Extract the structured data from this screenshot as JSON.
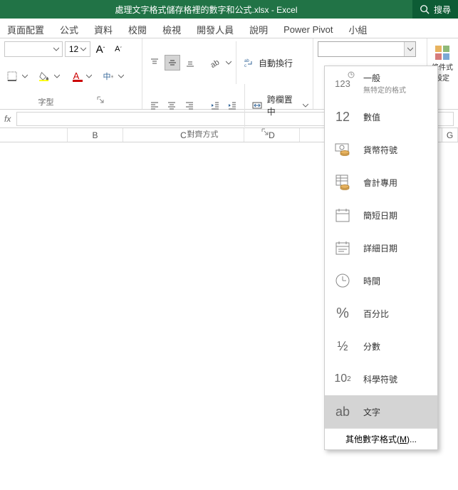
{
  "titlebar": {
    "title": "處理文字格式儲存格裡的數字和公式.xlsx - Excel",
    "search": "搜尋"
  },
  "tabs": [
    "頁面配置",
    "公式",
    "資料",
    "校閱",
    "檢視",
    "開發人員",
    "說明",
    "Power Pivot",
    "小組"
  ],
  "ribbon": {
    "font_size": "12",
    "a_large": "A",
    "a_small": "A",
    "cn_label": "中",
    "wrap_text": "自動換行",
    "merge_center": "跨欄置中",
    "group_font": "字型",
    "group_align": "對齊方式",
    "cond_fmt": "條件式",
    "cond_fmt_sub": "設定"
  },
  "numfmt": {
    "items": [
      {
        "icon": "123-clock",
        "label": "一般",
        "sub": "無特定的格式"
      },
      {
        "icon": "12",
        "label": "數值"
      },
      {
        "icon": "currency",
        "label": "貨幣符號"
      },
      {
        "icon": "accounting",
        "label": "會計專用"
      },
      {
        "icon": "date-short",
        "label": "簡短日期"
      },
      {
        "icon": "date-long",
        "label": "詳細日期"
      },
      {
        "icon": "clock",
        "label": "時間"
      },
      {
        "icon": "percent",
        "label": "百分比"
      },
      {
        "icon": "fraction",
        "label": "分數"
      },
      {
        "icon": "sci",
        "label": "科學符號"
      },
      {
        "icon": "ab",
        "label": "文字"
      }
    ],
    "more": "其他數字格式(",
    "more_u": "M",
    "more_end": ")..."
  },
  "formula_bar": {
    "fx": "fx"
  },
  "columns": [
    "",
    "B",
    "C",
    "D",
    "",
    "G"
  ]
}
